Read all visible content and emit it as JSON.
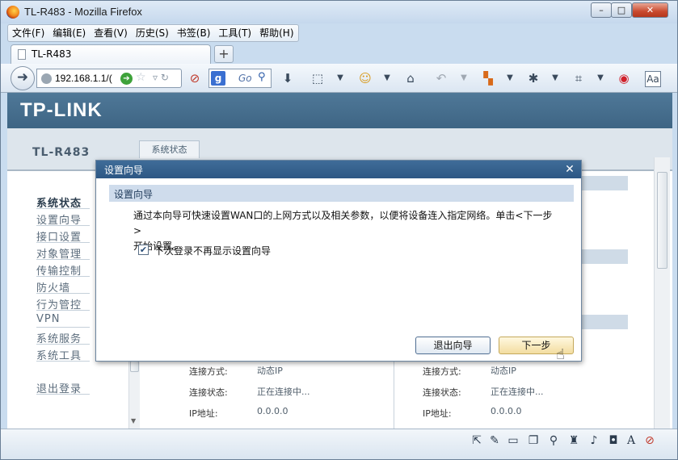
{
  "window": {
    "title": "TL-R483 - Mozilla Firefox",
    "min": "–",
    "max": "□",
    "close": "✕"
  },
  "menubar": [
    "文件(F)",
    "编辑(E)",
    "查看(V)",
    "历史(S)",
    "书签(B)",
    "工具(T)",
    "帮助(H)"
  ],
  "tabs": [
    {
      "label": "TL-R483"
    }
  ],
  "new_tab": "+",
  "nav": {
    "url": "192.168.1.1/(",
    "search_go": "Go",
    "search_engine": "g"
  },
  "router": {
    "logo": "TP-LINK",
    "model": "TL-R483",
    "top_tab": "系统状态",
    "sidebar": [
      "系统状态",
      "设置向导",
      "接口设置",
      "对象管理",
      "传输控制",
      "防火墙",
      "行为管控",
      "VPN",
      "系统服务",
      "系统工具"
    ],
    "logout": "退出登录",
    "wan_left": {
      "rows": [
        {
          "label": "连接方式:",
          "value": "动态IP"
        },
        {
          "label": "连接状态:",
          "value": "正在连接中..."
        },
        {
          "label": "IP地址:",
          "value": "0.0.0.0"
        }
      ]
    },
    "wan_right": {
      "rows": [
        {
          "label": "连接方式:",
          "value": "动态IP"
        },
        {
          "label": "连接状态:",
          "value": "正在连接中..."
        },
        {
          "label": "IP地址:",
          "value": "0.0.0.0"
        }
      ]
    }
  },
  "dialog": {
    "title": "设置向导",
    "close": "✕",
    "heading": "设置向导",
    "message_line1": "通过本向导可快速设置WAN口的上网方式以及相关参数，以便将设备连入指定网络。单击<下一步>",
    "message_line2": "开始设置。",
    "checkbox_label": "下次登录不再显示设置向导",
    "checkbox_checked": true,
    "exit_button": "退出向导",
    "next_button": "下一步"
  },
  "colors": {
    "header": "#4f7898",
    "dialog_title": "#3f6c98",
    "accent": "#cfdcec"
  }
}
